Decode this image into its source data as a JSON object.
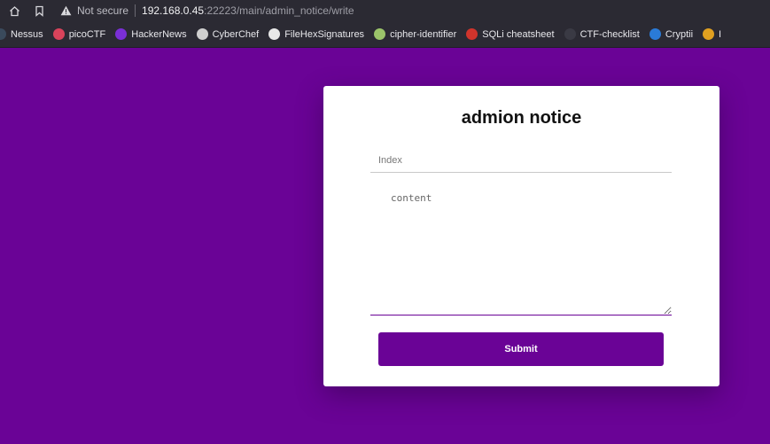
{
  "browser": {
    "security_label": "Not secure",
    "url_host": "192.168.0.45",
    "url_rest": ":22223/main/admin_notice/write",
    "bookmarks": [
      {
        "label": "Nessus",
        "color": "#3a4a5c",
        "icon": "nessus-icon"
      },
      {
        "label": "picoCTF",
        "color": "#d9435b",
        "icon": "picoctf-icon"
      },
      {
        "label": "HackerNews",
        "color": "#7a2fd6",
        "icon": "hackernews-icon"
      },
      {
        "label": "CyberChef",
        "color": "#cfcfcf",
        "icon": "cyberchef-icon"
      },
      {
        "label": "FileHexSignatures",
        "color": "#e8e8e8",
        "icon": "wikipedia-icon"
      },
      {
        "label": "cipher-identifier",
        "color": "#9bc46a",
        "icon": "cipher-icon"
      },
      {
        "label": "SQLi cheatsheet",
        "color": "#d0342c",
        "icon": "sqli-icon"
      },
      {
        "label": "CTF-checklist",
        "color": "#3a3a44",
        "icon": "github-icon"
      },
      {
        "label": "Cryptii",
        "color": "#2a7bd8",
        "icon": "cryptii-icon"
      },
      {
        "label": "I",
        "color": "#e0a020",
        "icon": "folder-icon"
      }
    ]
  },
  "form": {
    "title": "admion notice",
    "index_placeholder": "Index",
    "content_placeholder": "content",
    "submit_label": "Submit"
  },
  "colors": {
    "background": "#6a0396",
    "accent": "#6a0396",
    "card": "#ffffff"
  }
}
